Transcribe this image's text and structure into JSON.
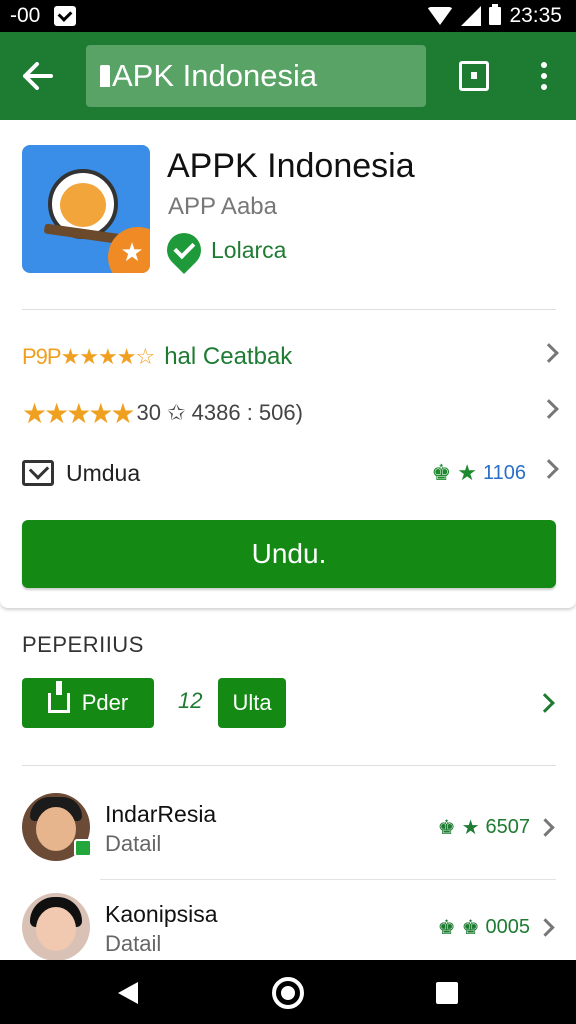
{
  "status_bar": {
    "left_text": "-00",
    "time": "23:35"
  },
  "app_bar": {
    "search_text": "APK Indonesia"
  },
  "app": {
    "title": "APPK Indonesia",
    "developer": "APP Aaba",
    "verified_label": "Lolarca"
  },
  "rows": {
    "row1": {
      "stars": "P9P★★★★☆",
      "text": "hal Ceatbak"
    },
    "row2": {
      "stars": "★★★★★",
      "text": "30 ✩ 4386 : 506)"
    },
    "row3": {
      "label": "Umdua",
      "value": "1106"
    }
  },
  "primary_button": {
    "label": "Undu."
  },
  "section": {
    "title": "PEPERIIUS",
    "chip1_label": "Pder",
    "mid_label": "12",
    "chip2_label": "Ulta"
  },
  "users": [
    {
      "name": "IndarResia",
      "sub": "Datail",
      "value": "6507"
    },
    {
      "name": "Kaonipsisa",
      "sub": "Datail",
      "value": "0005"
    }
  ],
  "colors": {
    "primary": "#1e7b32",
    "button": "#148a14",
    "star": "#f0a020"
  }
}
